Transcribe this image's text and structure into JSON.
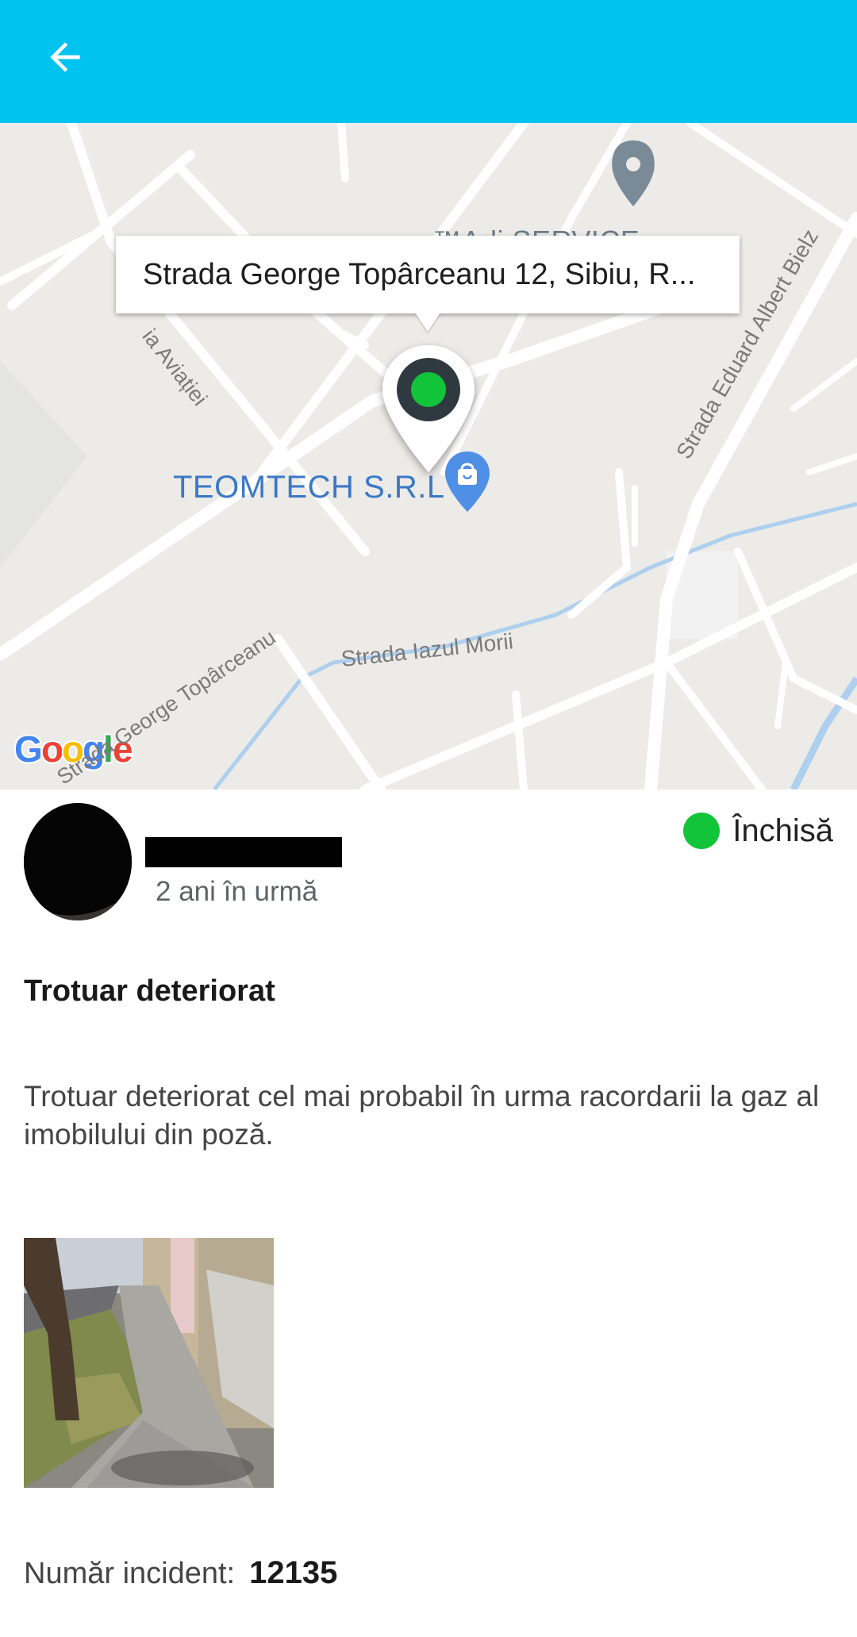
{
  "appbar": {
    "back_icon": "arrow-left-icon",
    "color": "#00c3f0"
  },
  "map": {
    "callout_address": "Strada George Topârceanu 12, Sibiu, R...",
    "poi_label": "TEOMTECH S.R.L",
    "poi_icon": "shopping-bag-icon",
    "partial_place_label": "™Adi SERVICE",
    "streets": [
      "ia Aviației",
      "Strada Eduard Albert Bielz",
      "Strada George Topârceanu",
      "Strada Iazul Morii"
    ],
    "marker_icon": "location-pin-icon",
    "marker_status_color": "#11c43a",
    "attribution": "Google"
  },
  "report": {
    "time_ago": "2 ani în urmă",
    "status": {
      "label": "Închisă",
      "color": "#11c43a"
    },
    "title": "Trotuar deteriorat",
    "description": "Trotuar deteriorat cel mai probabil în urma racordarii la gaz al imobilului din poză.",
    "incident_label": "Număr incident:",
    "incident_number": "12135"
  }
}
